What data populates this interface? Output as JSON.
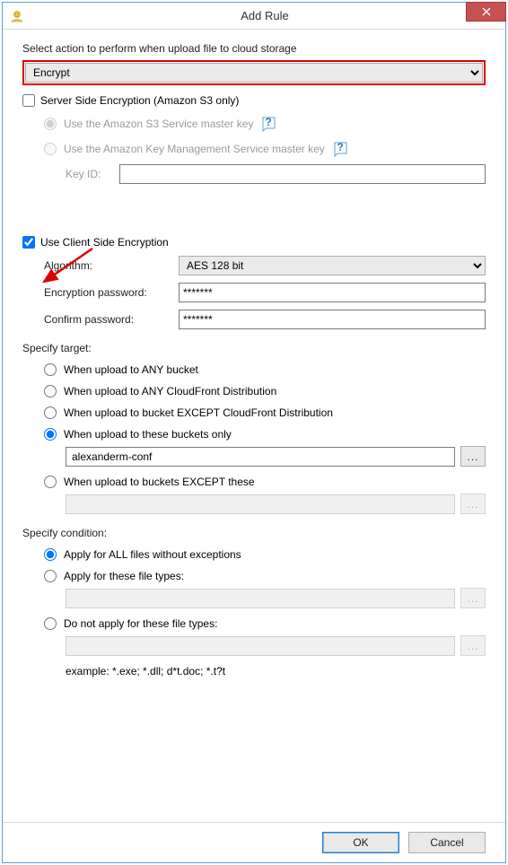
{
  "window": {
    "title": "Add Rule"
  },
  "instruction": "Select action to perform when upload file to cloud storage",
  "action": {
    "options": [
      "Encrypt"
    ],
    "selected": "Encrypt"
  },
  "sse": {
    "label": "Server Side Encryption (Amazon S3 only)",
    "checked": false,
    "opt_master": "Use the Amazon S3 Service master key",
    "opt_kms": "Use the Amazon Key Management Service master key",
    "key_id_label": "Key ID:",
    "key_id_value": ""
  },
  "cse": {
    "label": "Use Client Side Encryption",
    "checked": true,
    "algorithm_label": "Algorithm:",
    "algorithm_options": [
      "AES 128 bit"
    ],
    "algorithm_selected": "AES 128 bit",
    "password_label": "Encryption password:",
    "password_value": "*******",
    "confirm_label": "Confirm password:",
    "confirm_value": "*******"
  },
  "target": {
    "section_label": "Specify target:",
    "opt_any_bucket": "When upload to ANY bucket",
    "opt_any_cf": "When upload to ANY CloudFront Distribution",
    "opt_except_cf": "When upload to bucket EXCEPT CloudFront Distribution",
    "opt_these_only": "When upload to these buckets only",
    "opt_except_these": "When upload to buckets EXCEPT these",
    "selected": "these_only",
    "these_value": "alexanderm-conf",
    "except_value": ""
  },
  "condition": {
    "section_label": "Specify condition:",
    "opt_all": "Apply for ALL files without exceptions",
    "opt_these": "Apply for these file types:",
    "opt_not_these": "Do not apply for these file types:",
    "selected": "all",
    "these_value": "",
    "not_these_value": "",
    "example": "example: *.exe; *.dll; d*t.doc; *.t?t"
  },
  "buttons": {
    "ok": "OK",
    "cancel": "Cancel",
    "browse": "..."
  }
}
